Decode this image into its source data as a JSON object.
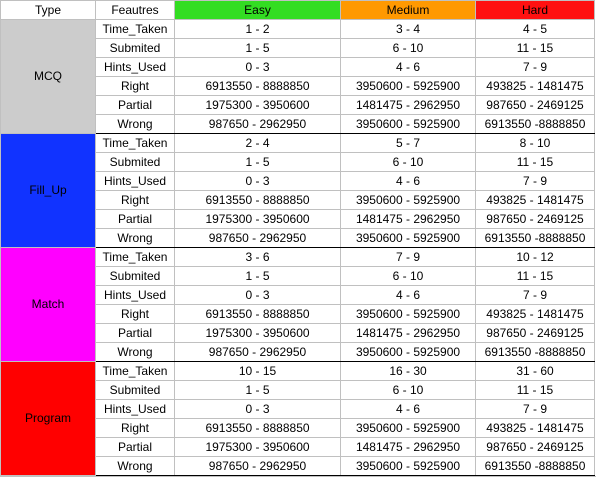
{
  "header": {
    "type": "Type",
    "features": "Feautres",
    "easy": "Easy",
    "medium": "Medium",
    "hard": "Hard"
  },
  "colors": {
    "header_bg": "#ffffff",
    "easy_header": "#33dd22",
    "medium_header": "#ff9900",
    "hard_header": "#ff1111",
    "mcq": "#cccccc",
    "fill_up": "#1133ff",
    "match": "#ff00ff",
    "program": "#ff0000"
  },
  "groups": [
    {
      "type": "MCQ",
      "rows": [
        {
          "feature": "Time_Taken",
          "easy": "1 - 2",
          "medium": "3 - 4",
          "hard": "4 - 5"
        },
        {
          "feature": "Submited",
          "easy": "1 - 5",
          "medium": "6 - 10",
          "hard": "11 - 15"
        },
        {
          "feature": "Hints_Used",
          "easy": "0 - 3",
          "medium": "4 - 6",
          "hard": "7 - 9"
        },
        {
          "feature": "Right",
          "easy": "6913550 - 8888850",
          "medium": "3950600 - 5925900",
          "hard": "493825 - 1481475"
        },
        {
          "feature": "Partial",
          "easy": "1975300 - 3950600",
          "medium": "1481475 - 2962950",
          "hard": "987650 - 2469125"
        },
        {
          "feature": "Wrong",
          "easy": "987650 - 2962950",
          "medium": "3950600 - 5925900",
          "hard": "6913550 -8888850"
        }
      ]
    },
    {
      "type": "Fill_Up",
      "rows": [
        {
          "feature": "Time_Taken",
          "easy": "2 - 4",
          "medium": "5 - 7",
          "hard": "8  - 10"
        },
        {
          "feature": "Submited",
          "easy": "1 - 5",
          "medium": "6 - 10",
          "hard": "11 - 15"
        },
        {
          "feature": "Hints_Used",
          "easy": "0 - 3",
          "medium": "4 - 6",
          "hard": "7 - 9"
        },
        {
          "feature": "Right",
          "easy": "6913550 - 8888850",
          "medium": "3950600 - 5925900",
          "hard": "493825 - 1481475"
        },
        {
          "feature": "Partial",
          "easy": "1975300 - 3950600",
          "medium": "1481475 - 2962950",
          "hard": "987650 - 2469125"
        },
        {
          "feature": "Wrong",
          "easy": "987650 - 2962950",
          "medium": "3950600 - 5925900",
          "hard": "6913550 -8888850"
        }
      ]
    },
    {
      "type": "Match",
      "rows": [
        {
          "feature": "Time_Taken",
          "easy": "3 - 6",
          "medium": "7 - 9",
          "hard": "10 - 12"
        },
        {
          "feature": "Submited",
          "easy": "1 - 5",
          "medium": "6 - 10",
          "hard": "11 - 15"
        },
        {
          "feature": "Hints_Used",
          "easy": "0 - 3",
          "medium": "4 - 6",
          "hard": "7 - 9"
        },
        {
          "feature": "Right",
          "easy": "6913550 - 8888850",
          "medium": "3950600 - 5925900",
          "hard": "493825 - 1481475"
        },
        {
          "feature": "Partial",
          "easy": "1975300 - 3950600",
          "medium": "1481475 - 2962950",
          "hard": "987650 - 2469125"
        },
        {
          "feature": "Wrong",
          "easy": "987650 - 2962950",
          "medium": "3950600 - 5925900",
          "hard": "6913550 -8888850"
        }
      ]
    },
    {
      "type": "Program",
      "rows": [
        {
          "feature": "Time_Taken",
          "easy": "10 - 15",
          "medium": "16 - 30",
          "hard": "31 - 60"
        },
        {
          "feature": "Submited",
          "easy": "1 - 5",
          "medium": "6 - 10",
          "hard": "11 - 15"
        },
        {
          "feature": "Hints_Used",
          "easy": "0 - 3",
          "medium": "4 - 6",
          "hard": "7 - 9"
        },
        {
          "feature": "Right",
          "easy": "6913550 - 8888850",
          "medium": "3950600 - 5925900",
          "hard": "493825 - 1481475"
        },
        {
          "feature": "Partial",
          "easy": "1975300 - 3950600",
          "medium": "1481475 - 2962950",
          "hard": "987650 - 2469125"
        },
        {
          "feature": "Wrong",
          "easy": "987650 - 2962950",
          "medium": "3950600 - 5925900",
          "hard": "6913550 -8888850"
        }
      ]
    }
  ]
}
